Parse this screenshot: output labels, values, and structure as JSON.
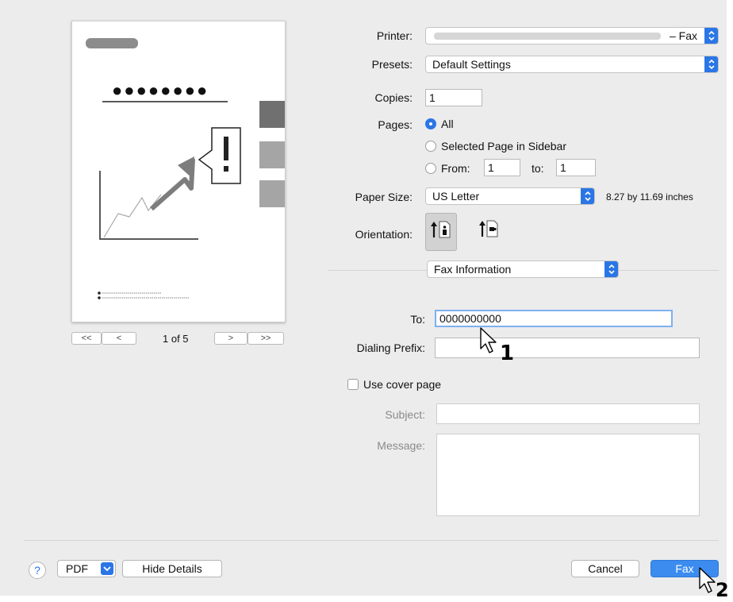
{
  "printer": {
    "label": "Printer:",
    "value": "– Fax"
  },
  "presets": {
    "label": "Presets:",
    "value": "Default Settings"
  },
  "copies": {
    "label": "Copies:",
    "value": "1"
  },
  "pages": {
    "label": "Pages:",
    "all": "All",
    "selected": "Selected Page in Sidebar",
    "from_label": "From:",
    "from_value": "1",
    "to_label": "to:",
    "to_value": "1"
  },
  "paper": {
    "label": "Paper Size:",
    "value": "US Letter",
    "dims": "8.27 by 11.69 inches"
  },
  "orientation": {
    "label": "Orientation:"
  },
  "section_popup": {
    "value": "Fax Information"
  },
  "fax": {
    "to_label": "To:",
    "to_value": "0000000000",
    "prefix_label": "Dialing Prefix:",
    "prefix_value": "",
    "cover_label": "Use cover page",
    "subject_label": "Subject:",
    "message_label": "Message:"
  },
  "preview": {
    "page_indicator": "1 of 5",
    "first": "<<",
    "prev": "<",
    "next": ">",
    "last": ">>",
    "masked_heading": "●●●●●●●●"
  },
  "footer": {
    "help": "?",
    "pdf": "PDF",
    "hide_details": "Hide Details",
    "cancel": "Cancel",
    "fax": "Fax"
  },
  "annotations": {
    "step1": "1",
    "step2": "2"
  },
  "colors": {
    "accent": "#2b76e6",
    "window_bg": "#ececec"
  }
}
